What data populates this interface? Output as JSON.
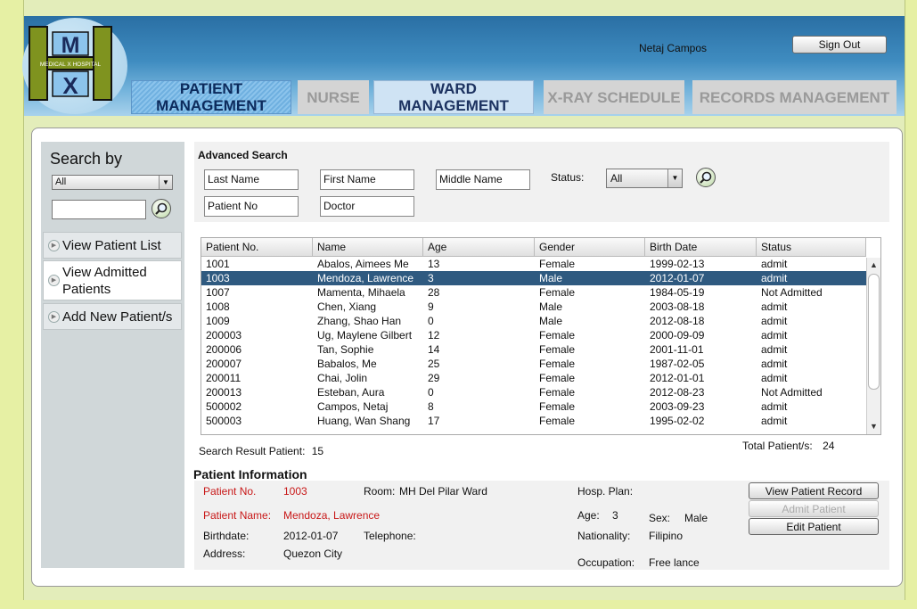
{
  "header": {
    "logo_text": "MEDICAL X HOSPITAL",
    "user_name": "Netaj Campos",
    "sign_out": "Sign Out"
  },
  "tabs": [
    {
      "label": "PATIENT MANAGEMENT",
      "state": "active"
    },
    {
      "label": "NURSE",
      "state": "disabled"
    },
    {
      "label": "WARD MANAGEMENT",
      "state": "enabled"
    },
    {
      "label": "X-RAY SCHEDULE",
      "state": "disabled"
    },
    {
      "label": "RECORDS MANAGEMENT",
      "state": "disabled"
    }
  ],
  "sidebar": {
    "title": "Search by",
    "filter_value": "All",
    "search_value": "",
    "items": [
      {
        "label": "View Patient List"
      },
      {
        "label": "View Admitted Patients"
      },
      {
        "label": "Add New Patient/s"
      }
    ]
  },
  "advanced": {
    "title": "Advanced Search",
    "last_name": "Last Name",
    "first_name": "First Name",
    "middle_name": "Middle Name",
    "patient_no": "Patient No",
    "doctor": "Doctor",
    "status_label": "Status:",
    "status_value": "All"
  },
  "table": {
    "columns": [
      "Patient No.",
      "Name",
      "Age",
      "Gender",
      "Birth Date",
      "Status"
    ],
    "selected_index": 1,
    "rows": [
      [
        "1001",
        "Abalos,  Aimees Me",
        "13",
        "Female",
        "1999-02-13",
        "admit"
      ],
      [
        "1003",
        "Mendoza,  Lawrence",
        "3",
        "Male",
        "2012-01-07",
        "admit"
      ],
      [
        "1007",
        "Mamenta,  Mihaela",
        "28",
        "Female",
        "1984-05-19",
        "Not Admitted"
      ],
      [
        "1008",
        "Chen,  Xiang",
        "9",
        "Male",
        "2003-08-18",
        "admit"
      ],
      [
        "1009",
        "Zhang,  Shao Han",
        "0",
        "Male",
        "2012-08-18",
        "admit"
      ],
      [
        "200003",
        "Ug,  Maylene Gilbert",
        "12",
        "Female",
        "2000-09-09",
        "admit"
      ],
      [
        "200006",
        "Tan,  Sophie",
        "14",
        "Female",
        "2001-11-01",
        "admit"
      ],
      [
        "200007",
        "Babalos,  Me",
        "25",
        "Female",
        "1987-02-05",
        "admit"
      ],
      [
        "200011",
        "Chai,  Jolin",
        "29",
        "Female",
        "2012-01-01",
        "admit"
      ],
      [
        "200013",
        "Esteban,  Aura",
        "0",
        "Female",
        "2012-08-23",
        "Not Admitted"
      ],
      [
        "500002",
        "Campos,  Netaj",
        "8",
        "Female",
        "2003-09-23",
        "admit"
      ],
      [
        "500003",
        "Huang,  Wan Shang",
        "17",
        "Female",
        "1995-02-02",
        "admit"
      ]
    ]
  },
  "result": {
    "search_result_label": "Search Result Patient:",
    "search_result_count": "15",
    "total_label": "Total Patient/s:",
    "total_count": "24"
  },
  "patient_info": {
    "title": "Patient Information",
    "patient_no_label": "Patient No.",
    "patient_no": "1003",
    "room_label": "Room:",
    "room": "MH Del Pilar Ward",
    "hosp_plan_label": "Hosp. Plan:",
    "hosp_plan": "",
    "patient_name_label": "Patient Name:",
    "patient_name": "Mendoza, Lawrence",
    "age_label": "Age:",
    "age": "3",
    "sex_label": "Sex:",
    "sex": "Male",
    "birthdate_label": "Birthdate:",
    "birthdate": "2012-01-07",
    "telephone_label": "Telephone:",
    "telephone": "",
    "nationality_label": "Nationality:",
    "nationality": "Filipino",
    "address_label": "Address:",
    "address": "Quezon City",
    "occupation_label": "Occupation:",
    "occupation": "Free lance"
  },
  "actions": {
    "view_record": "View Patient Record",
    "admit": "Admit Patient",
    "edit": "Edit Patient"
  }
}
